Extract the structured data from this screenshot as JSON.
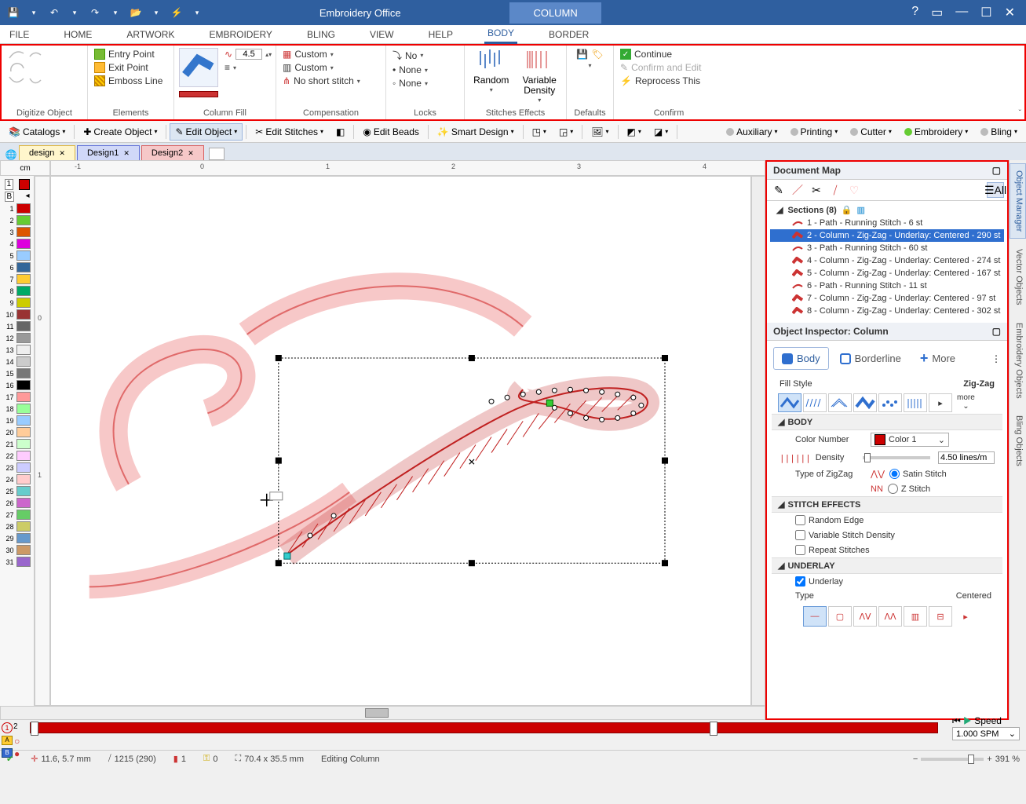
{
  "titlebar": {
    "app_title": "Embroidery Office",
    "context_tab": "COLUMN"
  },
  "menu": {
    "file": "FILE",
    "home": "HOME",
    "artwork": "ARTWORK",
    "embroidery": "EMBROIDERY",
    "bling": "BLING",
    "view": "VIEW",
    "help": "HELP",
    "body": "BODY",
    "border": "BORDER"
  },
  "ribbon": {
    "digitize_label": "Digitize Object",
    "elements_label": "Elements",
    "elements": {
      "entry": "Entry Point",
      "exit": "Exit Point",
      "emboss": "Emboss Line"
    },
    "columnfill_label": "Column Fill",
    "columnfill": {
      "density": "4.5"
    },
    "compensation_label": "Compensation",
    "compensation": {
      "r1": "Custom",
      "r2": "Custom",
      "r3": "No short stitch"
    },
    "locks_label": "Locks",
    "locks": {
      "r1": "No",
      "r2": "None",
      "r3": "None"
    },
    "stitches_label": "Stitches Effects",
    "stitches": {
      "random": "Random",
      "variable1": "Variable",
      "variable2": "Density"
    },
    "defaults_label": "Defaults",
    "confirm_label": "Confirm",
    "confirm": {
      "cont": "Continue",
      "confirm_edit": "Confirm and Edit",
      "reprocess": "Reprocess This"
    }
  },
  "toolbar2": {
    "catalogs": "Catalogs",
    "create": "Create Object",
    "edit": "Edit Object",
    "stitches": "Edit Stitches",
    "beads": "Edit Beads",
    "smart": "Smart Design",
    "aux": "Auxiliary",
    "printing": "Printing",
    "cutter": "Cutter",
    "emb": "Embroidery",
    "bling": "Bling"
  },
  "tabs": {
    "t0": "design",
    "t1": "Design1",
    "t2": "Design2"
  },
  "ruler": {
    "unit": "cm"
  },
  "docmap": {
    "title": "Document Map",
    "all": "All",
    "sections": "Sections (8)",
    "items": [
      "1 - Path - Running Stitch - 6 st",
      "2 - Column - Zig-Zag - Underlay: Centered - 290 st",
      "3 - Path - Running Stitch - 60 st",
      "4 - Column - Zig-Zag - Underlay: Centered - 274 st",
      "5 - Column - Zig-Zag - Underlay: Centered - 167 st",
      "6 - Path - Running Stitch - 11 st",
      "7 - Column - Zig-Zag - Underlay: Centered - 97 st",
      "8 - Column - Zig-Zag - Underlay: Centered - 302 st"
    ]
  },
  "inspector": {
    "title": "Object Inspector: Column",
    "tab_body": "Body",
    "tab_border": "Borderline",
    "tab_more": "More",
    "fillstyle_label": "Fill Style",
    "fillstyle_value": "Zig-Zag",
    "more": "more",
    "body_section": "BODY",
    "color_label": "Color Number",
    "color_value": "Color 1",
    "density_label": "Density",
    "density_value": "4.50 lines/m",
    "zigzag_label": "Type of ZigZag",
    "satin": "Satin Stitch",
    "zstitch": "Z Stitch",
    "effects_section": "STITCH EFFECTS",
    "random_edge": "Random Edge",
    "var_density": "Variable Stitch Density",
    "repeat": "Repeat Stitches",
    "underlay_section": "UNDERLAY",
    "underlay_chk": "Underlay",
    "type_label": "Type",
    "type_value": "Centered"
  },
  "sidetabs": {
    "om": "Object Manager",
    "vo": "Vector Objects",
    "eo": "Embroidery Objects",
    "bo": "Bling Objects"
  },
  "bottom": {
    "speed": "Speed",
    "speed_val": "1.000 SPM"
  },
  "status": {
    "pos": "11.6, 5.7 mm",
    "stitches": "1215 (290)",
    "sections": "1",
    "locks": "0",
    "size": "70.4 x 35.5 mm",
    "mode": "Editing Column",
    "zoom": "391 %"
  },
  "left_palette": {
    "labels": [
      "1",
      "2",
      "3",
      "4",
      "5",
      "6",
      "7",
      "8",
      "9",
      "10",
      "11",
      "12",
      "13",
      "14",
      "15",
      "16",
      "17",
      "18",
      "19",
      "20",
      "21",
      "22",
      "23",
      "24",
      "25",
      "26",
      "27",
      "28",
      "29",
      "30",
      "31"
    ],
    "colors": [
      "#c00",
      "#6c3",
      "#d50",
      "#d0d",
      "#9cf",
      "#369",
      "#fc3",
      "#0a6",
      "#cc0",
      "#933",
      "#666",
      "#999",
      "#eee",
      "#ccc",
      "#777",
      "#000",
      "#f99",
      "#9f9",
      "#9cf",
      "#fc9",
      "#cfc",
      "#fcf",
      "#ccf",
      "#fcc",
      "#6cc",
      "#c6c",
      "#6c6",
      "#cc6",
      "#69c",
      "#c96",
      "#96c"
    ]
  },
  "ruler_top_ticks": [
    "-1",
    "0",
    "1",
    "2",
    "3",
    "4"
  ],
  "ruler_left_ticks": [
    "0",
    "1"
  ]
}
